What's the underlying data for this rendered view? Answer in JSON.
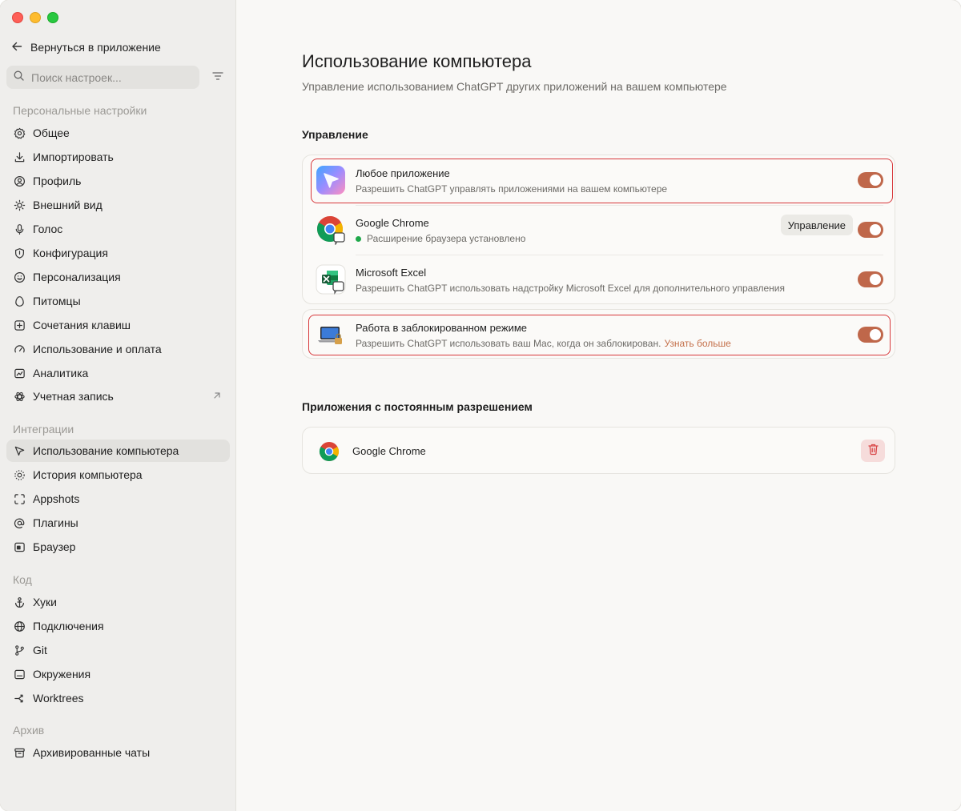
{
  "window": {
    "controls": [
      "close",
      "minimize",
      "zoom"
    ]
  },
  "sidebar": {
    "back_label": "Вернуться в приложение",
    "search_placeholder": "Поиск настроек...",
    "sections": [
      {
        "label": "Персональные настройки",
        "items": [
          {
            "label": "Общее",
            "icon": "gear-icon"
          },
          {
            "label": "Импортировать",
            "icon": "download-icon"
          },
          {
            "label": "Профиль",
            "icon": "user-circle-icon"
          },
          {
            "label": "Внешний вид",
            "icon": "sun-icon"
          },
          {
            "label": "Голос",
            "icon": "microphone-icon"
          },
          {
            "label": "Конфигурация",
            "icon": "shield-icon"
          },
          {
            "label": "Персонализация",
            "icon": "sparkle-circle-icon"
          },
          {
            "label": "Питомцы",
            "icon": "egg-icon"
          },
          {
            "label": "Сочетания клавиш",
            "icon": "keyboard-shortcut-icon"
          },
          {
            "label": "Использование и оплата",
            "icon": "gauge-icon"
          },
          {
            "label": "Аналитика",
            "icon": "chart-icon"
          },
          {
            "label": "Учетная запись",
            "icon": "openai-logo-icon",
            "external": true
          }
        ]
      },
      {
        "label": "Интеграции",
        "items": [
          {
            "label": "Использование компьютера",
            "icon": "cursor-icon",
            "active": true
          },
          {
            "label": "История компьютера",
            "icon": "dotted-circle-icon"
          },
          {
            "label": "Appshots",
            "icon": "screenshot-frame-icon"
          },
          {
            "label": "Плагины",
            "icon": "at-sign-icon"
          },
          {
            "label": "Браузер",
            "icon": "browser-window-icon"
          }
        ]
      },
      {
        "label": "Код",
        "items": [
          {
            "label": "Хуки",
            "icon": "anchor-icon"
          },
          {
            "label": "Подключения",
            "icon": "globe-icon"
          },
          {
            "label": "Git",
            "icon": "git-branch-icon"
          },
          {
            "label": "Окружения",
            "icon": "terminal-box-icon"
          },
          {
            "label": "Worktrees",
            "icon": "worktree-icon"
          }
        ]
      },
      {
        "label": "Архив",
        "items": [
          {
            "label": "Архивированные чаты",
            "icon": "archive-box-icon"
          }
        ]
      }
    ]
  },
  "main": {
    "title": "Использование компьютера",
    "subtitle": "Управление использованием ChatGPT других приложений на вашем компьютере",
    "control_section": {
      "title": "Управление",
      "rows": [
        {
          "title": "Любое приложение",
          "desc": "Разрешить ChatGPT управлять приложениями на вашем компьютере",
          "enabled": true,
          "highlighted": true,
          "icon": "computer-use-app-icon"
        },
        {
          "title": "Google Chrome",
          "desc": "Расширение браузера установлено",
          "status_color": "#1fa84a",
          "manage_label": "Управление",
          "enabled": true,
          "icon": "chrome-icon"
        },
        {
          "title": "Microsoft Excel",
          "desc": "Разрешить ChatGPT использовать надстройку Microsoft Excel для дополнительного управления",
          "enabled": true,
          "icon": "excel-icon"
        }
      ]
    },
    "locked_row": {
      "title": "Работа в заблокированном режиме",
      "desc": "Разрешить ChatGPT использовать ваш Mac, когда он заблокирован.",
      "link": "Узнать больше",
      "enabled": true,
      "highlighted": true,
      "icon": "locked-laptop-icon"
    },
    "permanent_section": {
      "title": "Приложения с постоянным разрешением",
      "apps": [
        {
          "name": "Google Chrome",
          "icon": "chrome-icon"
        }
      ]
    }
  },
  "colors": {
    "accent": "#bf674a",
    "highlight_border": "#d7383b",
    "link": "#c4704a",
    "delete_bg": "#f6dcdb",
    "delete_icon": "#d9494a"
  }
}
